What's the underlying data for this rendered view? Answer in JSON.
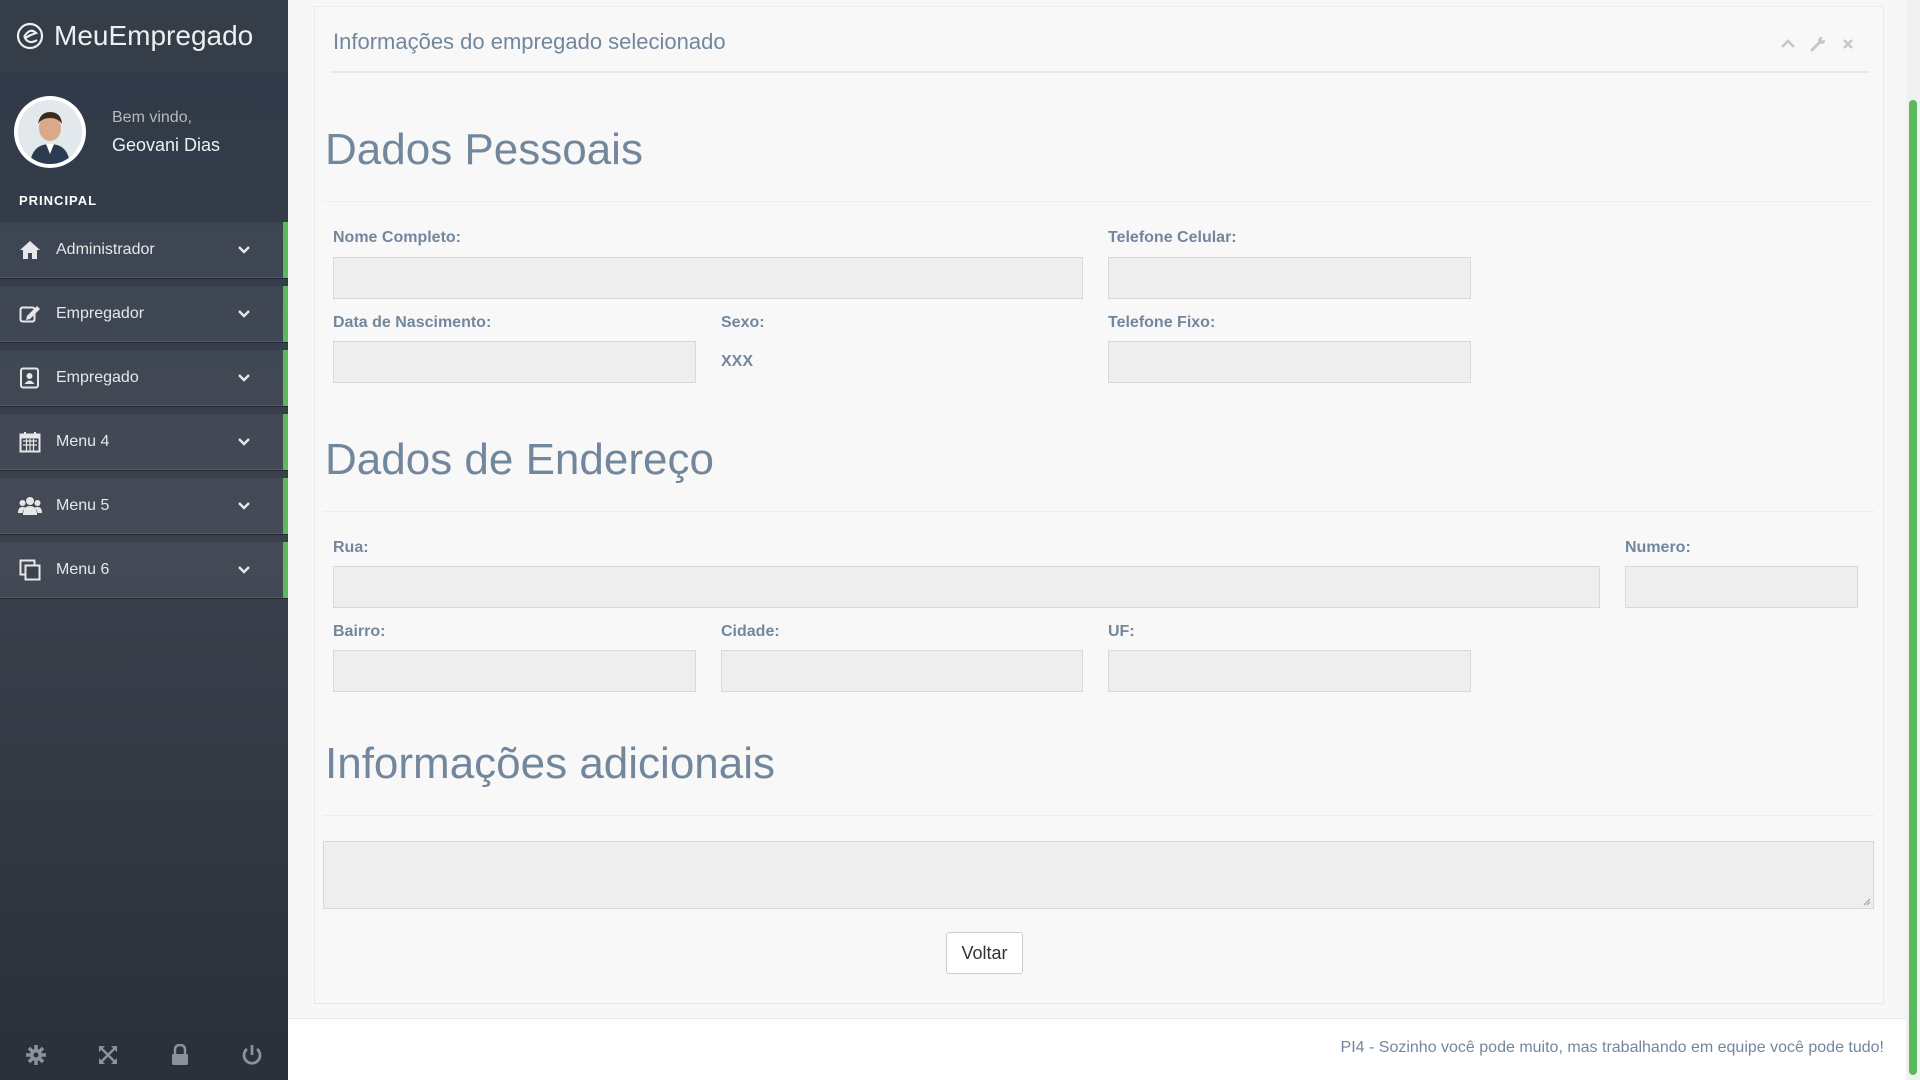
{
  "app": {
    "brand": "MeuEmpregado"
  },
  "user": {
    "welcome": "Bem vindo,",
    "name": "Geovani Dias"
  },
  "sidebar": {
    "section_title": "PRINCIPAL",
    "items": [
      {
        "label": "Administrador",
        "icon": "home-icon"
      },
      {
        "label": "Empregador",
        "icon": "edit-icon"
      },
      {
        "label": "Empregado",
        "icon": "contact-card-icon"
      },
      {
        "label": "Menu 4",
        "icon": "calendar-icon"
      },
      {
        "label": "Menu 5",
        "icon": "users-icon"
      },
      {
        "label": "Menu 6",
        "icon": "clone-icon"
      }
    ],
    "footer_icons": [
      "settings-icon",
      "fullscreen-icon",
      "lock-icon",
      "power-icon"
    ]
  },
  "panel": {
    "title": "Informações do empregado selecionado",
    "sections": {
      "personal": "Dados Pessoais",
      "address": "Dados de Endereço",
      "additional": "Informações adicionais"
    },
    "fields": {
      "full_name": {
        "label": "Nome Completo:",
        "value": ""
      },
      "mobile": {
        "label": "Telefone Celular:",
        "value": ""
      },
      "birth_date": {
        "label": "Data de Nascimento:",
        "value": ""
      },
      "sex": {
        "label": "Sexo:",
        "value": "XXX"
      },
      "landline": {
        "label": "Telefone Fixo:",
        "value": ""
      },
      "street": {
        "label": "Rua:",
        "value": ""
      },
      "number": {
        "label": "Numero:",
        "value": ""
      },
      "district": {
        "label": "Bairro:",
        "value": ""
      },
      "city": {
        "label": "Cidade:",
        "value": ""
      },
      "state": {
        "label": "UF:",
        "value": ""
      }
    },
    "back_button": "Voltar"
  },
  "footer": {
    "text": "PI4 - Sozinho você pode muito, mas trabalhando em equipe você pode tudo!"
  },
  "colors": {
    "accent": "#5cb85c",
    "sidebar_bg": "#353d48",
    "text": "#73879c"
  }
}
